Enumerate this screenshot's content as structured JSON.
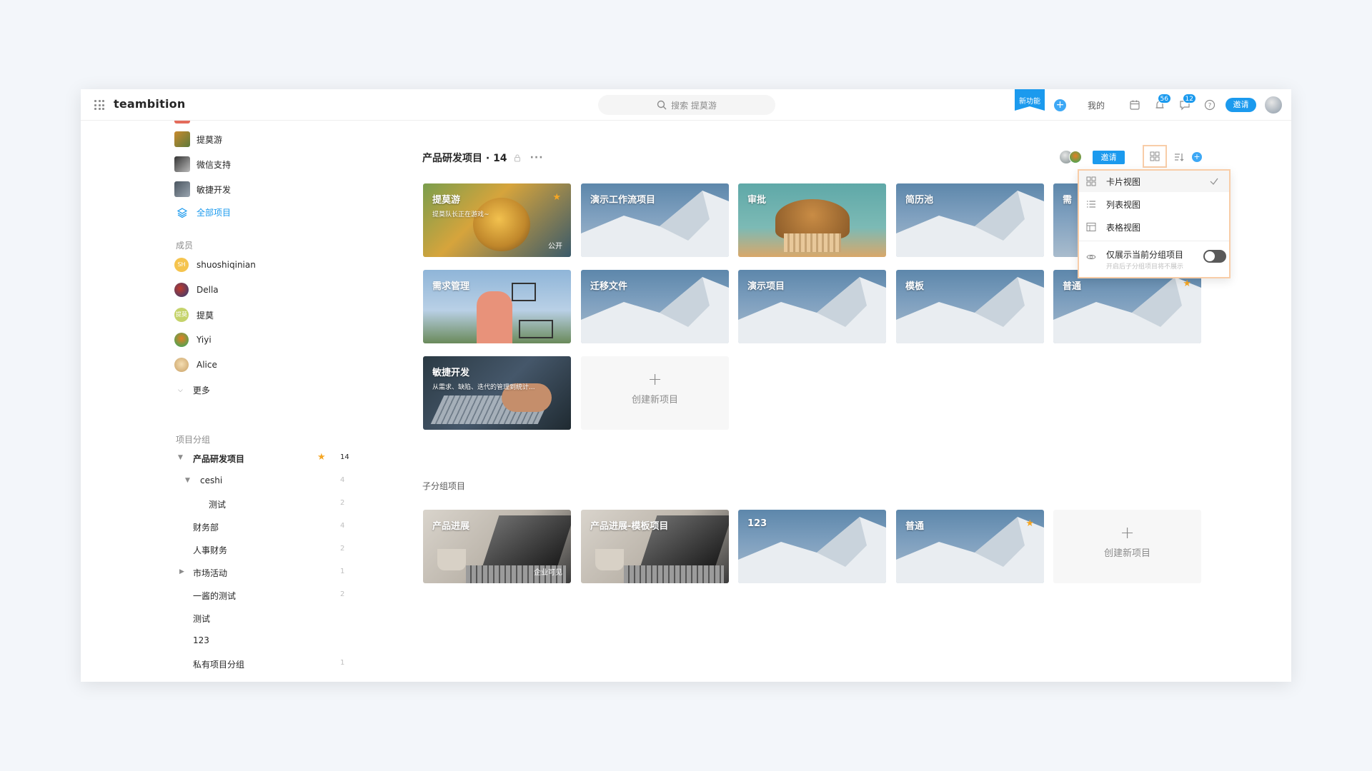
{
  "topbar": {
    "logo": "teambition",
    "search_placeholder": "搜索 提莫游",
    "new_feature": "新功能",
    "mine": "我的",
    "badge_notify": "56",
    "badge_inbox": "12",
    "invite": "邀请"
  },
  "sidebar": {
    "projects": [
      {
        "name": "提莫游"
      },
      {
        "name": "微信支持"
      },
      {
        "name": "敏捷开发"
      }
    ],
    "all_projects": "全部项目",
    "members_head": "成员",
    "members": [
      {
        "name": "shuoshiqinian",
        "initials": "SH"
      },
      {
        "name": "Della",
        "initials": ""
      },
      {
        "name": "提莫",
        "initials": "提莫"
      },
      {
        "name": "Yiyi",
        "initials": ""
      },
      {
        "name": "Alice",
        "initials": ""
      }
    ],
    "more": "更多",
    "groups_head": "项目分组",
    "groups": [
      {
        "name": "产品研发项目",
        "count": "14"
      },
      {
        "name": "ceshi",
        "count": "4"
      },
      {
        "name": "测试",
        "count": "2"
      },
      {
        "name": "财务部",
        "count": "4"
      },
      {
        "name": "人事财务",
        "count": "2"
      },
      {
        "name": "市场活动",
        "count": "1"
      },
      {
        "name": "一酱的测试",
        "count": "2"
      },
      {
        "name": "测试",
        "count": ""
      },
      {
        "name": "123",
        "count": ""
      },
      {
        "name": "私有项目分组",
        "count": "1"
      }
    ]
  },
  "main": {
    "title": "产品研发项目 · 14",
    "invite": "邀请",
    "cards": [
      {
        "title": "提莫游",
        "subtitle": "提莫队长正在游戏~",
        "tag": "公开"
      },
      {
        "title": "演示工作流项目"
      },
      {
        "title": "审批"
      },
      {
        "title": "简历池"
      },
      {
        "title": "需"
      },
      {
        "title": "需求管理"
      },
      {
        "title": "迁移文件"
      },
      {
        "title": "演示项目"
      },
      {
        "title": "模板"
      },
      {
        "title": "普通"
      },
      {
        "title": "敏捷开发",
        "subtitle": "从需求、缺陷、迭代的管理到统计..."
      }
    ],
    "create_label": "创建新项目",
    "sub_head": "子分组项目",
    "sub_cards": [
      {
        "title": "产品进展",
        "tag": "企业可见"
      },
      {
        "title": "产品进展-模板项目"
      },
      {
        "title": "123"
      },
      {
        "title": "普通"
      }
    ]
  },
  "dropdown": {
    "card_view": "卡片视图",
    "list_view": "列表视图",
    "table_view": "表格视图",
    "only_current": "仅展示当前分组项目",
    "only_current_hint": "开启后子分组项目将不展示"
  }
}
